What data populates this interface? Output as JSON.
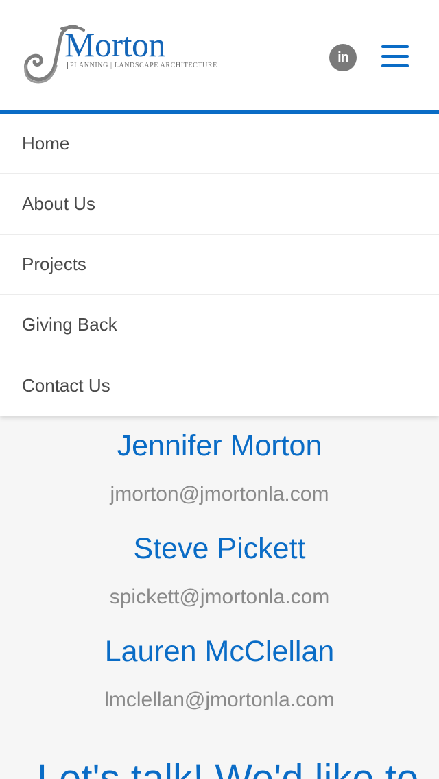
{
  "header": {
    "logo": {
      "wordmark": "Morton",
      "tagline": "PLANNING | LANDSCAPE ARCHITECTURE",
      "icon": "j-monogram-logo"
    },
    "social": {
      "icon": "linkedin-icon",
      "label": "in"
    },
    "menu": {
      "icon": "hamburger-menu-icon"
    }
  },
  "colors": {
    "accent": "#0a6cc6",
    "nav_text": "#4a4a4a",
    "email_text": "#8a8a8a"
  },
  "nav": {
    "items": [
      {
        "label": "Home"
      },
      {
        "label": "About Us"
      },
      {
        "label": "Projects"
      },
      {
        "label": "Giving Back"
      },
      {
        "label": "Contact Us"
      }
    ]
  },
  "contacts": [
    {
      "name": "Jennifer Morton",
      "email": "jmorton@jmortonla.com"
    },
    {
      "name": "Steve Pickett",
      "email": "spickett@jmortonla.com"
    },
    {
      "name": "Lauren McClellan",
      "email": "lmclellan@jmortonla.com"
    }
  ],
  "cta": {
    "heading": "Let's talk! We'd like to"
  }
}
